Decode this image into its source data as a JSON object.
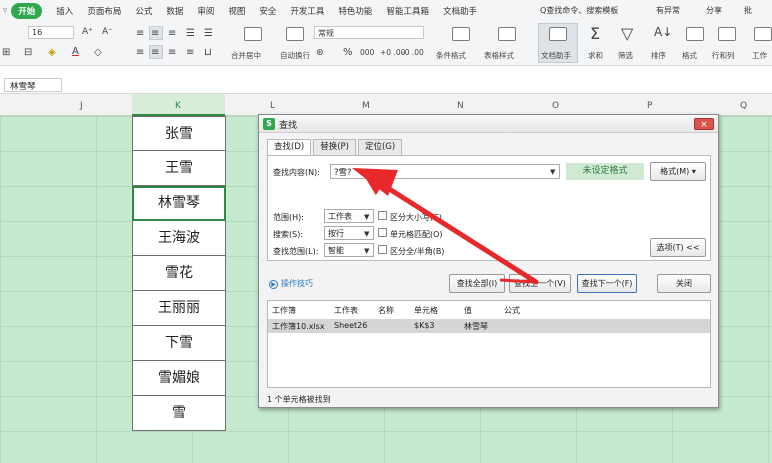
{
  "menu": {
    "active_tab": "开始",
    "tabs": [
      "插入",
      "页面布局",
      "公式",
      "数据",
      "审阅",
      "视图",
      "安全",
      "开发工具",
      "特色功能",
      "智能工具箱",
      "文档助手"
    ],
    "search_label": "Q查找命令、搜索模板",
    "right_items": [
      "有异常",
      "分享",
      "批"
    ]
  },
  "toolbar": {
    "font_size": "16",
    "number_format": "常规",
    "font_grow": "A⁺",
    "font_shrink": "A⁻",
    "merge_label": "合并居中",
    "wrap_label": "自动换行",
    "percent": "%",
    "thousand": "000",
    "dec_inc": "+0 .00",
    "dec_dec": "-0 .00",
    "cond_format": "条件格式",
    "table_style": "表格样式",
    "doc_assist": "文档助手",
    "sum": "求和",
    "filter": "筛选",
    "sort": "排序",
    "format": "格式",
    "rowcol": "行和列",
    "worksheet": "工作"
  },
  "formula_bar": {
    "value": "林雪琴"
  },
  "columns": [
    "J",
    "K",
    "L",
    "M",
    "N",
    "O",
    "P",
    "Q"
  ],
  "cells_k": [
    "张雪",
    "王雪",
    "林雪琴",
    "王海波",
    "雪花",
    "王丽丽",
    "下雪",
    "雪媚娘",
    "雪"
  ],
  "dialog": {
    "title": "查找",
    "close_label": "×",
    "tabs": [
      "查找(D)",
      "替换(P)",
      "定位(G)"
    ],
    "find_label": "查找内容(N):",
    "find_value": "?雪?",
    "no_format": "未设定格式",
    "format_btn": "格式(M)",
    "scope_label": "范围(H):",
    "scope_value": "工作表",
    "search_label": "搜索(S):",
    "search_value": "按行",
    "lookin_label": "查找范围(L):",
    "lookin_value": "智能",
    "case_label": "区分大小写(C)",
    "whole_label": "单元格匹配(O)",
    "width_label": "区分全/半角(B)",
    "options_btn": "选项(T) <<",
    "tips": "操作技巧",
    "find_all": "查找全部(I)",
    "find_prev": "查找上一个(V)",
    "find_next": "查找下一个(F)",
    "close_btn": "关闭",
    "result_headers": [
      "工作簿",
      "工作表",
      "名称",
      "单元格",
      "值",
      "公式"
    ],
    "result_row": [
      "工作簿10.xlsx",
      "Sheet26",
      "",
      "$K$3",
      "林雪琴",
      ""
    ],
    "status": "1 个单元格被找到"
  }
}
